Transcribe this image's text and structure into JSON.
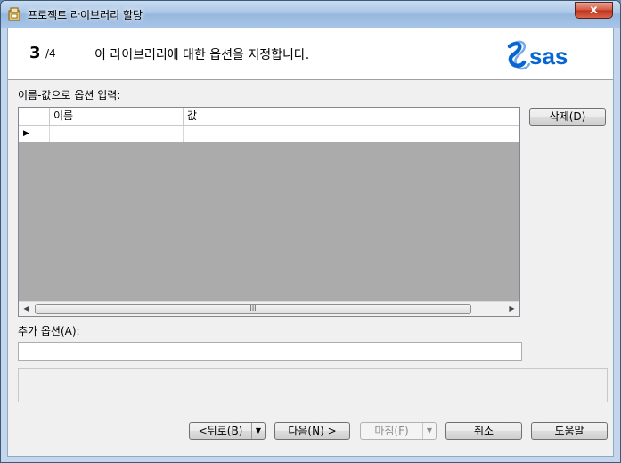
{
  "window": {
    "title": "프로젝트 라이브러리 할당",
    "close_label": "x"
  },
  "header": {
    "step_current": "3",
    "step_total": "/4",
    "title": "이 라이브러리에 대한 옵션을 지정합니다.",
    "logo_text": "sas",
    "brand_color": "#0766d1"
  },
  "options_section": {
    "label": "이름-값으로 옵션 입력:",
    "columns": [
      "이름",
      "값"
    ],
    "row_marker": "▶",
    "delete_button": "삭제(D)",
    "delete_mnemonic": "D",
    "scroll_grip": "III"
  },
  "additional": {
    "label": "추가 옵션(A):",
    "value": ""
  },
  "footer": {
    "back": "<뒤로(B)",
    "next": "다음(N) >",
    "finish": "마침(F)",
    "cancel": "취소",
    "help": "도움말"
  }
}
